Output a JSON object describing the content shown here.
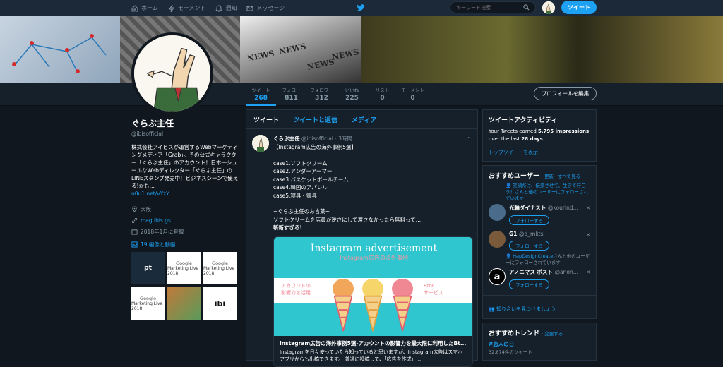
{
  "nav": {
    "home": "ホーム",
    "moments": "モーメント",
    "notifications": "通知",
    "messages": "メッセージ"
  },
  "search": {
    "placeholder": "キーワード検索"
  },
  "top_tweet_button": "ツイート",
  "banner": {
    "news_words": [
      "NEWS",
      "NEWS",
      "NEWS",
      "NEWS"
    ]
  },
  "stats": [
    {
      "label": "ツイート",
      "value": "268"
    },
    {
      "label": "フォロー",
      "value": "811"
    },
    {
      "label": "フォロワー",
      "value": "312"
    },
    {
      "label": "いいね",
      "value": "225"
    },
    {
      "label": "リスト",
      "value": "0"
    },
    {
      "label": "モーメント",
      "value": "0"
    }
  ],
  "edit_profile": "プロフィールを編集",
  "profile": {
    "name": "ぐらぶ主任",
    "handle": "@ibisofficial",
    "bio": "株式会社アイビスが運営するWebマーケティングメディア「Grab」。その公式キャラクター「ぐらぶ主任」のアカウント！日本一シュールなWebディレクター「ぐらぶ主任」のLINEスタンプ発売中！ビジネスシーンで使える!かも…",
    "bio_link": "u0u1.net/vYzY",
    "location": "大阪",
    "website": "mag.ibis.gs",
    "joined": "2018年1月に登録",
    "media_link": "19 画像と動画"
  },
  "media_thumbs": [
    {
      "text": "pt"
    },
    {
      "text": "Google",
      "sub": "Marketing Live 2018"
    },
    {
      "text": "Google",
      "sub": "Marketing Live 2018"
    },
    {
      "text": "Google",
      "sub": "Marketing Live 2018"
    },
    {
      "text": ""
    },
    {
      "text": "ibi"
    }
  ],
  "tabs": [
    "ツイート",
    "ツイートと返信",
    "メディア"
  ],
  "tweet": {
    "name": "ぐらぶ主任",
    "handle": "@ibisofficial",
    "time": "3時間",
    "headline": "【Instagram広告の海外事例5選】",
    "lines": [
      "case1.ソフトクリーム",
      "case2.アンダーアーマー",
      "case3.バスケットボールチーム",
      "case4.韓国のアパレル",
      "case5.寝具・家具",
      "",
      "~ぐらぶ主任のお言葉~",
      "ソフトクリームを店員が逆さにして渡さなかったら無料って…",
      "斬新すぎる!"
    ],
    "card": {
      "title": "Instagram advertisement",
      "subtitle": "Instagram広告の海外事例",
      "left_label_1": "アカウントの",
      "left_label_2": "影響力を活用",
      "right_label_1": "BtoC",
      "right_label_2": "サービス",
      "foot_title": "Instagram広告の海外事例5選-アカウントの影響力を最大限に利用したBt...",
      "foot_desc": "Instagramを日々使っていたら知っていると思いますが、Instagram広告はスマホアプリからも出稿できます。 普通に投稿して、「広告を作成」..."
    }
  },
  "activity": {
    "title": "ツイートアクティビティ",
    "text_1": "Your Tweets earned",
    "impressions": "5,795 impressions",
    "text_2": "over the last",
    "days": "28 days",
    "link": "トップツイートを表示"
  },
  "suggestions": {
    "title": "おすすめユーザー",
    "links": "· 更新 · すべて見る",
    "users": [
      {
        "context": "笑顔だけ、伝染させて、生きて行こう！さんと他のユーザーにフォローされています",
        "name": "光輪ダイナスト",
        "handle": "@kourind...",
        "follow": "フォローする",
        "color": "#4a6b8a"
      },
      {
        "context": "",
        "name": "G1",
        "handle": "@d_mkts",
        "follow": "フォローする",
        "color": "#7a5a3a"
      },
      {
        "context_link": "HapDesignCreate",
        "context": "さんと他のユーザーにフォローされています",
        "name": "アノニマス ポスト",
        "handle": "@anon...",
        "follow": "フォローする",
        "color": "#000000"
      }
    ],
    "find_friends": "知り合いを見つけましょう"
  },
  "trends": {
    "title": "おすすめトレンド",
    "change": "· 変更する",
    "items": [
      {
        "name": "#恋人の日",
        "count": "32,874件のツイート"
      }
    ]
  },
  "colors": {
    "accent": "#1da1f2",
    "bg": "#10171e",
    "panel": "#15202b"
  }
}
